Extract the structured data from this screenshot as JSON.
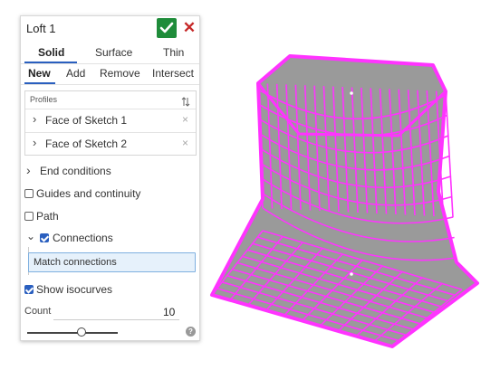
{
  "feature": {
    "title": "Loft 1",
    "icons": {
      "accept": "check-icon",
      "cancel": "close-icon"
    },
    "colors": {
      "accept": "#1f8c3a",
      "cancel": "#c62828",
      "accent": "#2a5fbf",
      "model": "#ff33ff"
    }
  },
  "body_type_tabs": [
    {
      "label": "Solid",
      "selected": true
    },
    {
      "label": "Surface",
      "selected": false
    },
    {
      "label": "Thin",
      "selected": false
    }
  ],
  "operation_tabs": [
    {
      "label": "New",
      "selected": true
    },
    {
      "label": "Add",
      "selected": false
    },
    {
      "label": "Remove",
      "selected": false
    },
    {
      "label": "Intersect",
      "selected": false
    }
  ],
  "profiles": {
    "label": "Profiles",
    "sort_icon": "sort-icon",
    "items": [
      {
        "label": "Face of Sketch 1",
        "icon": "chevron-right-icon"
      },
      {
        "label": "Face of Sketch 2",
        "icon": "chevron-right-icon"
      }
    ]
  },
  "end_conditions": {
    "label": "End conditions",
    "expanded": false
  },
  "guides": {
    "label": "Guides and continuity",
    "checked": false
  },
  "path": {
    "label": "Path",
    "checked": false
  },
  "connections": {
    "label": "Connections",
    "checked": true,
    "expanded": true,
    "field_value": "Match connections"
  },
  "isocurves": {
    "label": "Show isocurves",
    "checked": true
  },
  "count": {
    "label": "Count",
    "value": "10",
    "slider_fraction": 0.6
  },
  "help_icon": "help-icon"
}
